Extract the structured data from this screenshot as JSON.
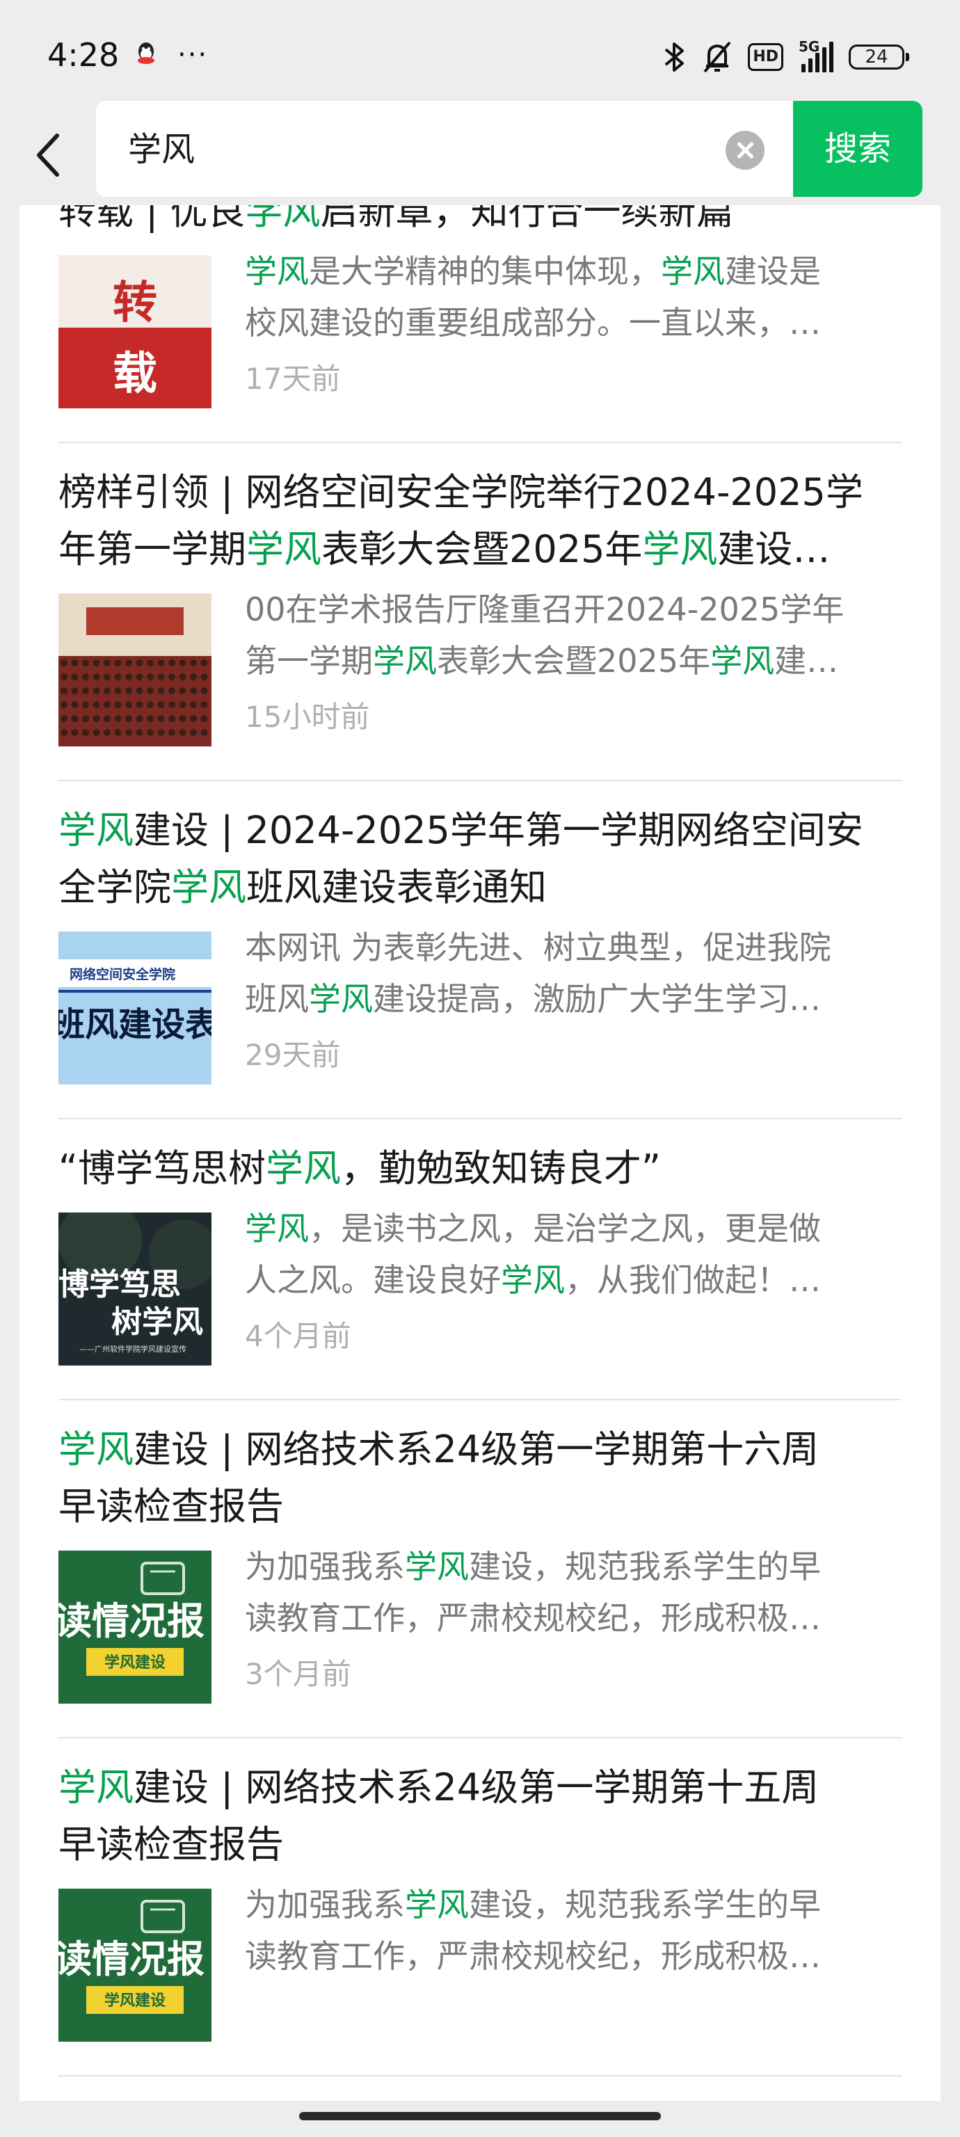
{
  "status": {
    "time": "4:28",
    "more": "···",
    "hd": "HD",
    "network": "5G",
    "battery": "24"
  },
  "search": {
    "query": "学风",
    "button": "搜索"
  },
  "colors": {
    "accent": "#07c160",
    "highlight": "#07a04f",
    "meta": "#b0b0b0"
  },
  "results": [
    {
      "title_lines": [
        [
          {
            "t": "转载 | 优良"
          },
          {
            "t": "学风",
            "h": true
          },
          {
            "t": "启新章，知行合一续新篇"
          }
        ]
      ],
      "desc_lines": [
        [
          {
            "t": "学风",
            "h": true
          },
          {
            "t": "是大学精神的集中体现，"
          },
          {
            "t": "学风",
            "h": true
          },
          {
            "t": "建设是"
          }
        ],
        [
          {
            "t": "校风建设的重要组成部分。一直以来，…"
          }
        ]
      ],
      "thumb": {
        "type": "zhuanzai",
        "text1": "转",
        "text2": "载"
      },
      "time": "17天前"
    },
    {
      "title_lines": [
        [
          {
            "t": "榜样引领 | 网络空间安全学院举行2024-2025学"
          }
        ],
        [
          {
            "t": "年第一学期"
          },
          {
            "t": "学风",
            "h": true
          },
          {
            "t": "表彰大会暨2025年"
          },
          {
            "t": "学风",
            "h": true
          },
          {
            "t": "建设…"
          }
        ]
      ],
      "desc_lines": [
        [
          {
            "t": "00在学术报告厅隆重召开2024-2025学年"
          }
        ],
        [
          {
            "t": "第一学期"
          },
          {
            "t": "学风",
            "h": true
          },
          {
            "t": "表彰大会暨2025年"
          },
          {
            "t": "学风",
            "h": true
          },
          {
            "t": "建…"
          }
        ]
      ],
      "thumb": {
        "type": "hall"
      },
      "time": "15小时前"
    },
    {
      "title_lines": [
        [
          {
            "t": "学风",
            "h": true
          },
          {
            "t": "建设 | 2024-2025学年第一学期网络空间安"
          }
        ],
        [
          {
            "t": "全学院"
          },
          {
            "t": "学风",
            "h": true
          },
          {
            "t": "班风建设表彰通知"
          }
        ]
      ],
      "desc_lines": [
        [
          {
            "t": "本网讯 为表彰先进、树立典型，促进我院"
          }
        ],
        [
          {
            "t": "班风"
          },
          {
            "t": "学风",
            "h": true
          },
          {
            "t": "建设提高，激励广大学生学习…"
          }
        ]
      ],
      "thumb": {
        "type": "banner",
        "text1": "网络空间安全学院",
        "text2": "班风建设表彰"
      },
      "time": "29天前"
    },
    {
      "title_lines": [
        [
          {
            "t": " “博学笃思树"
          },
          {
            "t": "学风",
            "h": true
          },
          {
            "t": "，勤勉致知铸良才”"
          }
        ]
      ],
      "desc_lines": [
        [
          {
            "t": "学风",
            "h": true
          },
          {
            "t": "，是读书之风，是治学之风，更是做"
          }
        ],
        [
          {
            "t": "人之风。建设良好"
          },
          {
            "t": "学风",
            "h": true
          },
          {
            "t": "，从我们做起！…"
          }
        ]
      ],
      "thumb": {
        "type": "dark",
        "text1": "博学笃思",
        "text2": "树学风",
        "text3": "——广州软件学院学风建设宣传"
      },
      "time": "4个月前"
    },
    {
      "title_lines": [
        [
          {
            "t": "学风",
            "h": true
          },
          {
            "t": "建设 | 网络技术系24级第一学期第十六周"
          }
        ],
        [
          {
            "t": "早读检查报告"
          }
        ]
      ],
      "desc_lines": [
        [
          {
            "t": "为加强我系"
          },
          {
            "t": "学风",
            "h": true
          },
          {
            "t": "建设，规范我系学生的早"
          }
        ],
        [
          {
            "t": "读教育工作，严肃校规校纪，形成积极…"
          }
        ]
      ],
      "thumb": {
        "type": "green",
        "text1": "读情况报",
        "text2": "学风建设"
      },
      "time": "3个月前"
    },
    {
      "title_lines": [
        [
          {
            "t": "学风",
            "h": true
          },
          {
            "t": "建设 | 网络技术系24级第一学期第十五周"
          }
        ],
        [
          {
            "t": "早读检查报告"
          }
        ]
      ],
      "desc_lines": [
        [
          {
            "t": "为加强我系"
          },
          {
            "t": "学风",
            "h": true
          },
          {
            "t": "建设，规范我系学生的早"
          }
        ],
        [
          {
            "t": "读教育工作，严肃校规校纪，形成积极…"
          }
        ]
      ],
      "thumb": {
        "type": "green",
        "text1": "读情况报",
        "text2": "学风建设"
      },
      "time": ""
    }
  ]
}
